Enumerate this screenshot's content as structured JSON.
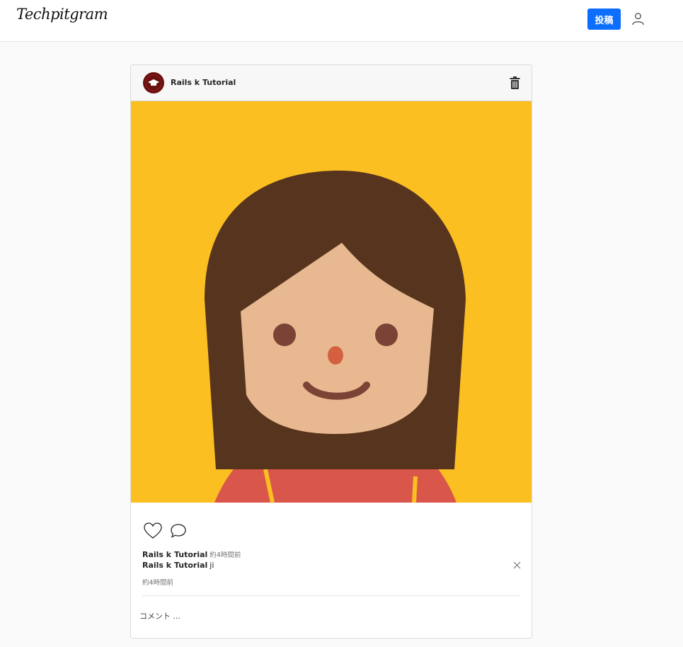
{
  "header": {
    "logo_text": "Techpitgram",
    "post_button_label": "投稿",
    "user_icon": "user-icon"
  },
  "post": {
    "username": "Rails k Tutorial",
    "avatar_icon": "graduation-cap-badge",
    "delete_icon": "trash-icon",
    "image_description_icon": "girl-avatar-illustration",
    "actions": {
      "like_icon": "heart-icon",
      "comment_icon": "speech-bubble-icon"
    },
    "caption": {
      "username": "Rails k Tutorial",
      "time": "約4時間前"
    },
    "comments": [
      {
        "username": "Rails k Tutorial",
        "text": "ji",
        "time": "約4時間前"
      }
    ],
    "comment_placeholder": "コメント ..."
  },
  "colors": {
    "accent": "#0d6efd",
    "photo_background": "#fbbf22",
    "hair": "#56341e",
    "skin": "#e8b990",
    "shirt": "#d9574a"
  }
}
